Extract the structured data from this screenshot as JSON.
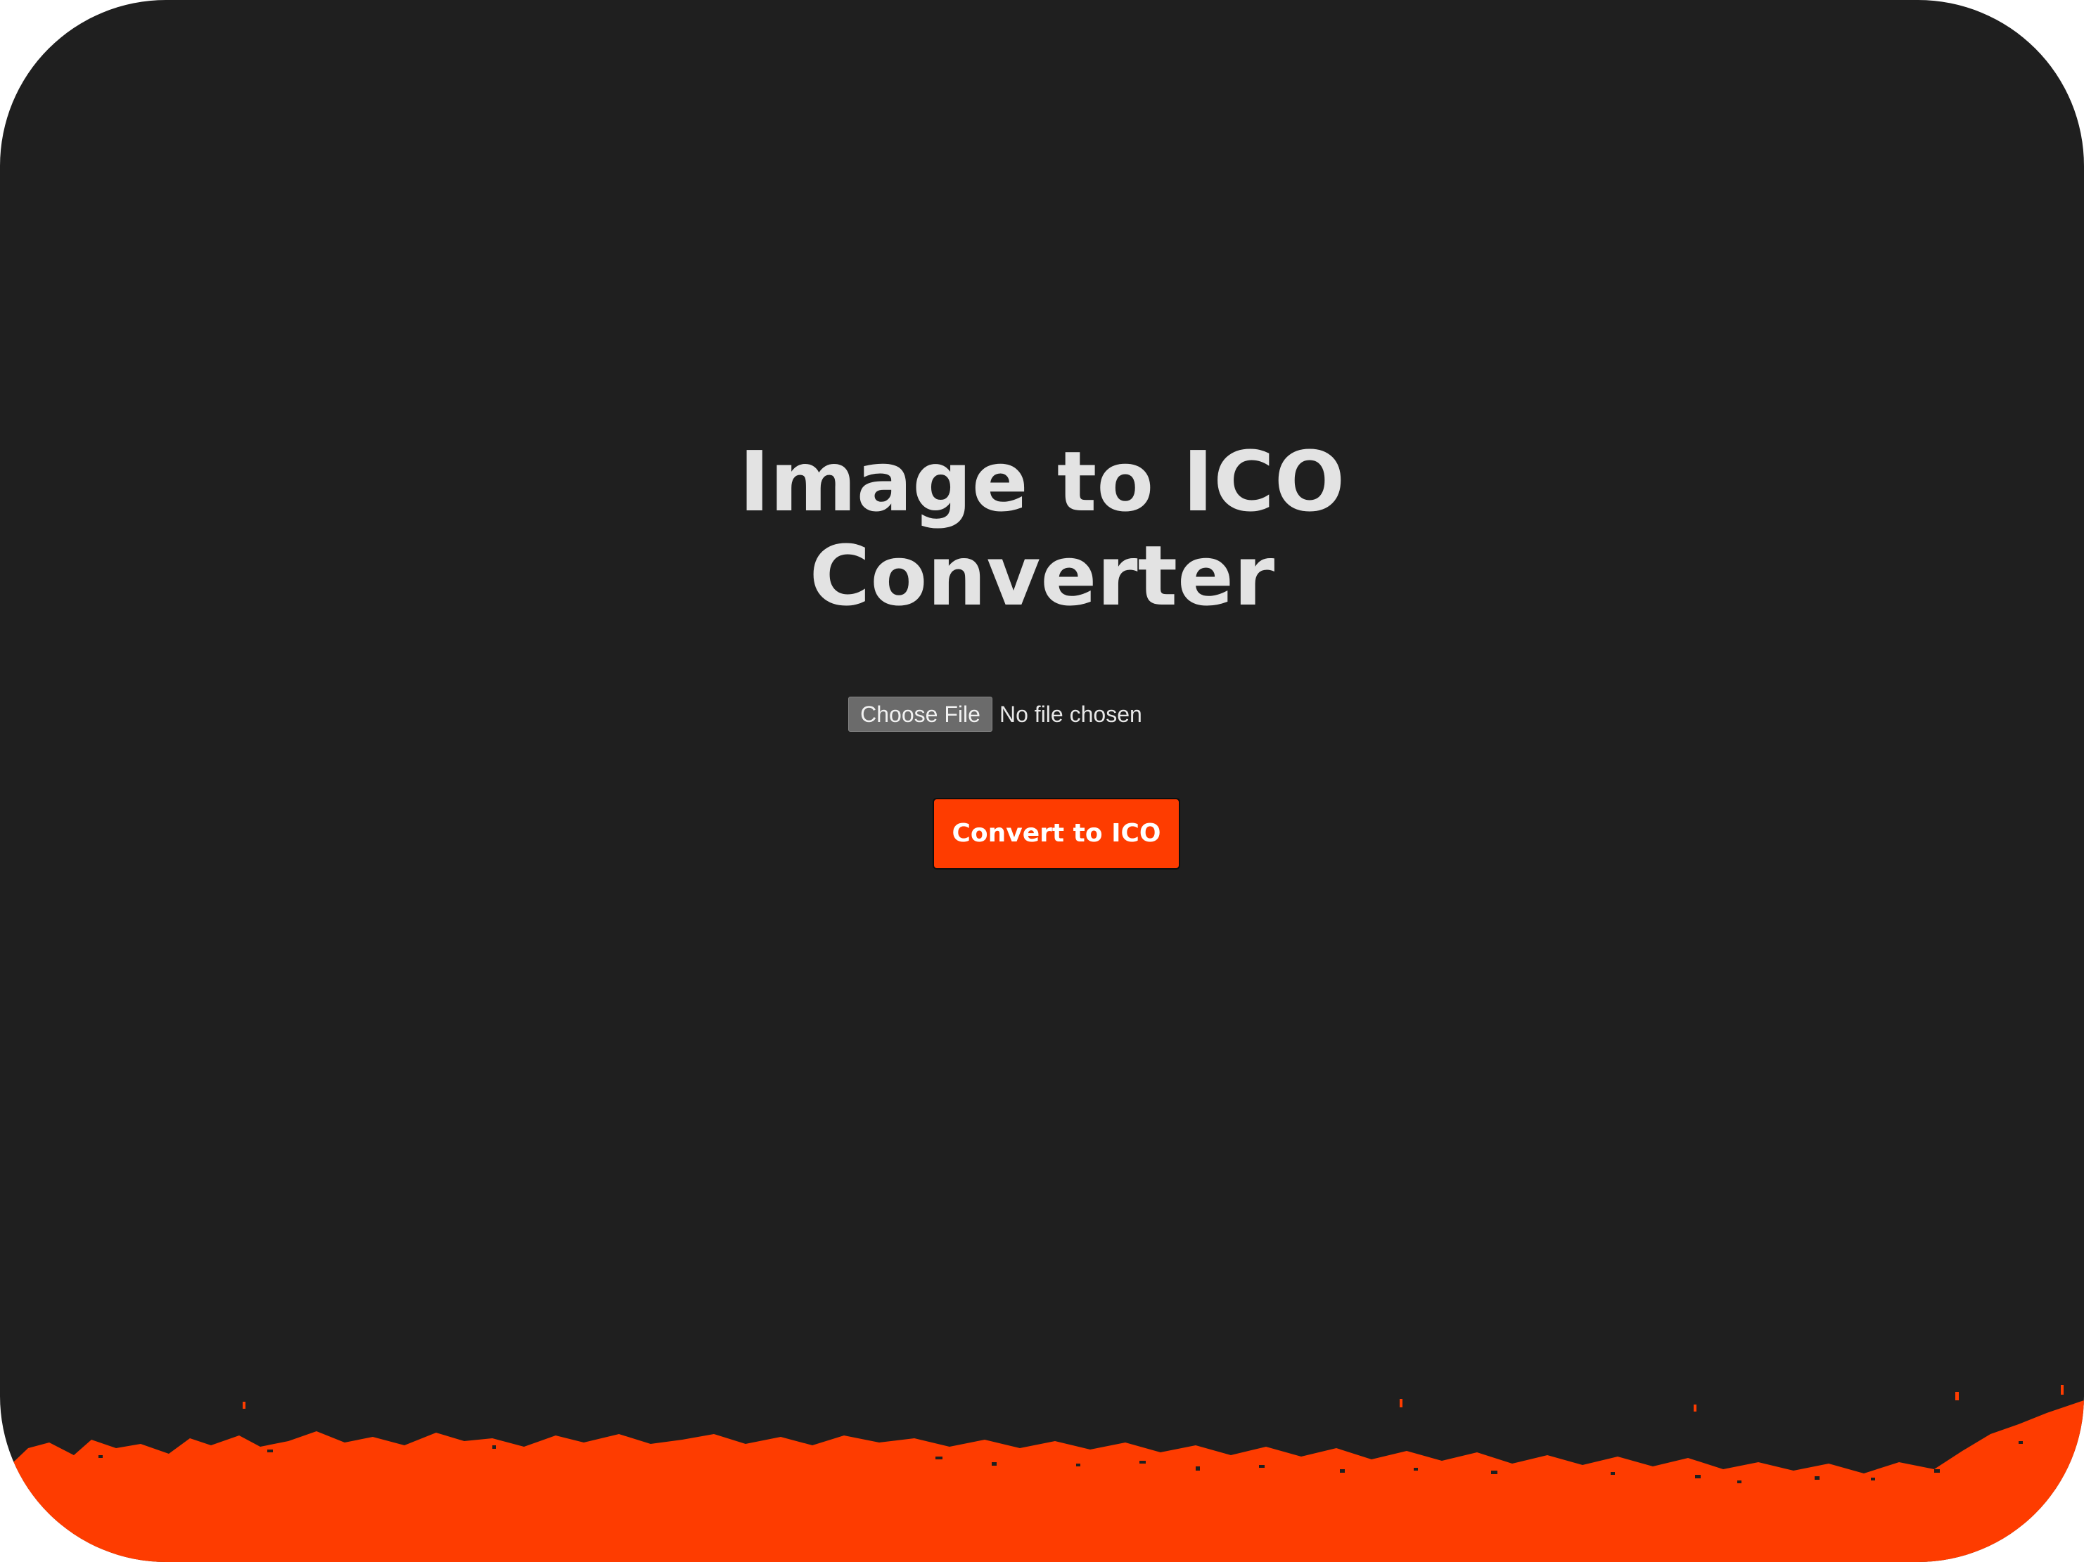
{
  "app": {
    "title_line1": "Image to ICO",
    "title_line2": "Converter"
  },
  "file_input": {
    "button_label": "Choose File",
    "status_text": "No file chosen"
  },
  "actions": {
    "convert_label": "Convert to ICO"
  },
  "colors": {
    "background": "#1f1f1f",
    "accent": "#fe3c00",
    "title_text": "#e3e3e3",
    "choose_button_bg": "#6b6b6b"
  },
  "decoration": {
    "footer": "orange-paint-stroke"
  }
}
